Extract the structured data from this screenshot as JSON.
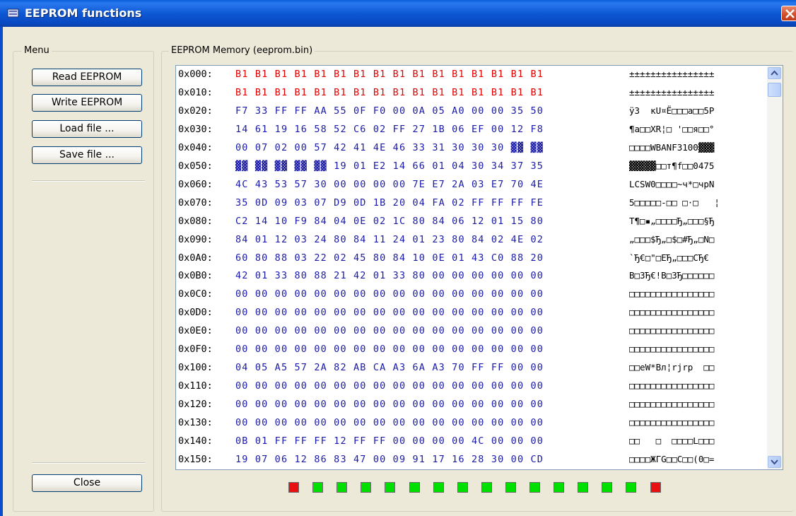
{
  "window": {
    "title": "EEPROM functions"
  },
  "menu": {
    "group_label": "Menu",
    "buttons": {
      "read": "Read EEPROM",
      "write": "Write EEPROM",
      "load": "Load file ...",
      "save": "Save file ...",
      "close": "Close"
    }
  },
  "memory": {
    "group_label": "EEPROM Memory (eeprom.bin)",
    "rows": [
      {
        "addr": "0x000:",
        "bytes": "B1 B1 B1 B1 B1 B1 B1 B1 B1 B1 B1 B1 B1 B1 B1 B1",
        "ascii": "±±±±±±±±±±±±±±±±",
        "highlight": true
      },
      {
        "addr": "0x010:",
        "bytes": "B1 B1 B1 B1 B1 B1 B1 B1 B1 B1 B1 B1 B1 B1 B1 B1",
        "ascii": "±±±±±±±±±±±±±±±±",
        "highlight": true
      },
      {
        "addr": "0x020:",
        "bytes": "F7 33 FF FF AA 55 0F F0 00 0A 05 A0 00 00 35 50",
        "ascii": "ÿ3  кU¤Ё□□□а□□5P",
        "highlight": false
      },
      {
        "addr": "0x030:",
        "bytes": "14 61 19 16 58 52 C6 02 FF 27 1B 06 EF 00 12 F8",
        "ascii": "¶a□□XR¦□ '□□я□□°",
        "highlight": false
      },
      {
        "addr": "0x040:",
        "bytes": "00 07 02 00 57 42 41 4E 46 33 31 30 30 30 ▓▓ ▓▓",
        "ascii": "□□□□WBANF3100▓▓▓",
        "highlight": false
      },
      {
        "addr": "0x050:",
        "bytes": "▓▓ ▓▓ ▓▓ ▓▓ ▓▓ 19 01 E2 14 66 01 04 30 34 37 35",
        "ascii": "▓▓▓▓▓□□т¶f□□0475",
        "highlight": false
      },
      {
        "addr": "0x060:",
        "bytes": "4C 43 53 57 30 00 00 00 00 7E E7 2A 03 E7 70 4E",
        "ascii": "LCSW0□□□□~ч*□чpN",
        "highlight": false
      },
      {
        "addr": "0x070:",
        "bytes": "35 0D 09 03 07 D9 0D 1B 20 04 FA 02 FF FF FF FE",
        "ascii": "5□□□□□-□□ □·□   ¦",
        "highlight": false
      },
      {
        "addr": "0x080:",
        "bytes": "C2 14 10 F9 84 04 0E 02 1C 80 84 06 12 01 15 80",
        "ascii": "Т¶□▪„□□□□Ђ„□□□§Ђ",
        "highlight": false
      },
      {
        "addr": "0x090:",
        "bytes": "84 01 12 03 24 80 84 11 24 01 23 80 84 02 4E 02",
        "ascii": "„□□□$Ђ„□$□#Ђ„□N□",
        "highlight": false
      },
      {
        "addr": "0x0A0:",
        "bytes": "60 80 88 03 22 02 45 80 84 10 0E 01 43 C0 88 20",
        "ascii": "`Ђ€□\"□EЂ„□□□CЂ€ ",
        "highlight": false
      },
      {
        "addr": "0x0B0:",
        "bytes": "42 01 33 80 88 21 42 01 33 80 00 00 00 00 00 00",
        "ascii": "B□3Ђ€!B□3Ђ□□□□□□",
        "highlight": false
      },
      {
        "addr": "0x0C0:",
        "bytes": "00 00 00 00 00 00 00 00 00 00 00 00 00 00 00 00",
        "ascii": "□□□□□□□□□□□□□□□□",
        "highlight": false
      },
      {
        "addr": "0x0D0:",
        "bytes": "00 00 00 00 00 00 00 00 00 00 00 00 00 00 00 00",
        "ascii": "□□□□□□□□□□□□□□□□",
        "highlight": false
      },
      {
        "addr": "0x0E0:",
        "bytes": "00 00 00 00 00 00 00 00 00 00 00 00 00 00 00 00",
        "ascii": "□□□□□□□□□□□□□□□□",
        "highlight": false
      },
      {
        "addr": "0x0F0:",
        "bytes": "00 00 00 00 00 00 00 00 00 00 00 00 00 00 00 00",
        "ascii": "□□□□□□□□□□□□□□□□",
        "highlight": false
      },
      {
        "addr": "0x100:",
        "bytes": "04 05 A5 57 2A 82 AB CA A3 6A A3 70 FF FF 00 00",
        "ascii": "□□eW*Bл¦rjrp  □□",
        "highlight": false
      },
      {
        "addr": "0x110:",
        "bytes": "00 00 00 00 00 00 00 00 00 00 00 00 00 00 00 00",
        "ascii": "□□□□□□□□□□□□□□□□",
        "highlight": false
      },
      {
        "addr": "0x120:",
        "bytes": "00 00 00 00 00 00 00 00 00 00 00 00 00 00 00 00",
        "ascii": "□□□□□□□□□□□□□□□□",
        "highlight": false
      },
      {
        "addr": "0x130:",
        "bytes": "00 00 00 00 00 00 00 00 00 00 00 00 00 00 00 00",
        "ascii": "□□□□□□□□□□□□□□□□",
        "highlight": false
      },
      {
        "addr": "0x140:",
        "bytes": "0B 01 FF FF FF 12 FF FF 00 00 00 00 4C 00 00 00",
        "ascii": "□□   □  □□□□L□□□",
        "highlight": false
      },
      {
        "addr": "0x150:",
        "bytes": "19 07 06 12 86 83 47 00 09 91 17 16 28 30 00 CD",
        "ascii": "□□□□ЖГG□□С□□(0□=",
        "highlight": false
      }
    ]
  },
  "status_indicators": [
    "red",
    "green",
    "green",
    "green",
    "green",
    "green",
    "green",
    "green",
    "green",
    "green",
    "green",
    "green",
    "green",
    "green",
    "green",
    "red"
  ],
  "colors": {
    "highlight_bytes": "#e00000",
    "normal_bytes": "#1a1aa8",
    "indicator_ok": "#00e000",
    "indicator_err": "#e81010"
  }
}
